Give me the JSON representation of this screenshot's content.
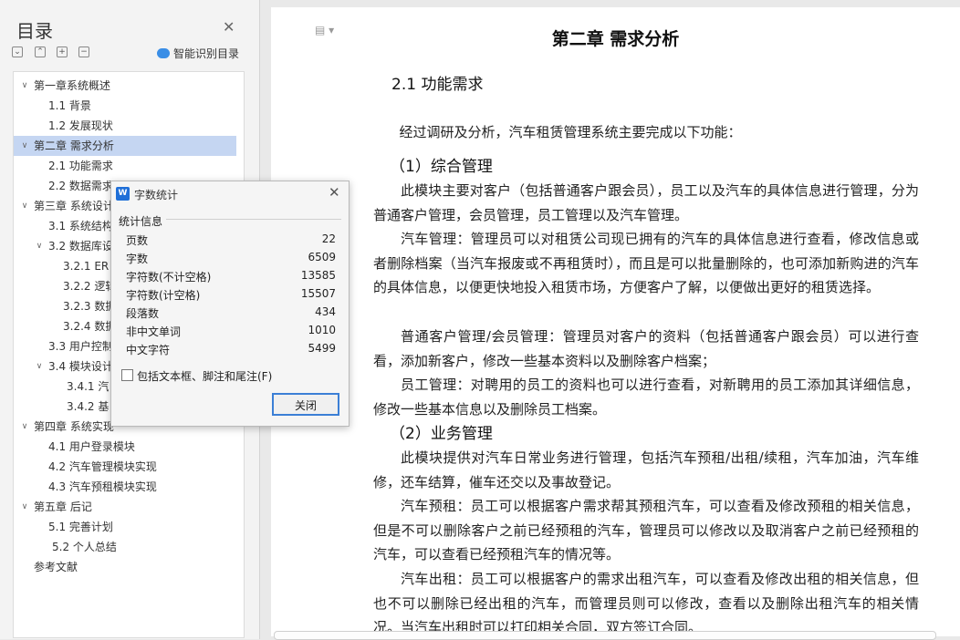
{
  "toc": {
    "title": "目录",
    "smart_label": "智能识别目录",
    "toolbar": [
      "⌄",
      "⌃",
      "+",
      "−"
    ],
    "items": [
      {
        "label": "第一章系统概述",
        "level": 0,
        "expanded": true
      },
      {
        "label": "1.1 背景",
        "level": 1
      },
      {
        "label": "1.2 发展现状",
        "level": 1
      },
      {
        "label": "第二章 需求分析",
        "level": 0,
        "expanded": true,
        "selected": true
      },
      {
        "label": "2.1 功能需求",
        "level": 1
      },
      {
        "label": "2.2 数据需求",
        "level": 1
      },
      {
        "label": "第三章 系统设计",
        "level": 0,
        "expanded": true
      },
      {
        "label": "3.1 系统结构",
        "level": 1
      },
      {
        "label": "3.2 数据库设",
        "level": 1,
        "expanded": true
      },
      {
        "label": "3.2.1 ER 图",
        "level": 2
      },
      {
        "label": "3.2.2 逻辑",
        "level": 2
      },
      {
        "label": "3.2.3 数据",
        "level": 2
      },
      {
        "label": "3.2.4 数据",
        "level": 2
      },
      {
        "label": "3.3 用户控制",
        "level": 1
      },
      {
        "label": "3.4 模块设计",
        "level": 1,
        "expanded": true
      },
      {
        "label": "3.4.1 汽",
        "level": 3
      },
      {
        "label": "3.4.2 基",
        "level": 3
      },
      {
        "label": "第四章 系统实现",
        "level": 0,
        "expanded": true
      },
      {
        "label": "4.1 用户登录模块",
        "level": 1
      },
      {
        "label": "4.2 汽车管理模块实现",
        "level": 1
      },
      {
        "label": "4.3 汽车预租模块实现",
        "level": 1
      },
      {
        "label": "第五章 后记",
        "level": 0,
        "expanded": true
      },
      {
        "label": "5.1 完善计划",
        "level": 1
      },
      {
        "label": "5.2 个人总结",
        "level": 4
      },
      {
        "label": "参考文献",
        "level": 0,
        "expanded": false
      }
    ]
  },
  "doc": {
    "chapter_title": "第二章  需求分析",
    "section_title": "2.1  功能需求",
    "blocks": [
      {
        "type": "p",
        "text": "经过调研及分析，汽车租赁管理系统主要完成以下功能："
      },
      {
        "type": "h",
        "text": "（1）综合管理"
      },
      {
        "type": "p",
        "text": "此模块主要对客户（包括普通客户跟会员），员工以及汽车的具体信息进行管理，分为普通客户管理，会员管理，员工管理以及汽车管理。"
      },
      {
        "type": "p",
        "text": "汽车管理：管理员可以对租赁公司现已拥有的汽车的具体信息进行查看，修改信息或者删除档案（当汽车报废或不再租赁时），而且是可以批量删除的，也可添加新购进的汽车的具体信息，以便更快地投入租赁市场，方便客户了解，以便做出更好的租赁选择。"
      },
      {
        "type": "p",
        "text": "普通客户管理/会员管理：管理员对客户的资料（包括普通客户跟会员）可以进行查看，添加新客户，修改一些基本资料以及删除客户档案；"
      },
      {
        "type": "p",
        "text": "员工管理：对聘用的员工的资料也可以进行查看，对新聘用的员工添加其详细信息，修改一些基本信息以及删除员工档案。"
      },
      {
        "type": "h",
        "text": "（2）业务管理"
      },
      {
        "type": "p",
        "text": "此模块提供对汽车日常业务进行管理，包括汽车预租/出租/续租，汽车加油，汽车维修，还车结算，催车还交以及事故登记。"
      },
      {
        "type": "p",
        "text": "汽车预租：员工可以根据客户需求帮其预租汽车，可以查看及修改预租的相关信息，但是不可以删除客户之前已经预租的汽车，管理员可以修改以及取消客户之前已经预租的汽车，可以查看已经预租汽车的情况等。"
      },
      {
        "type": "p",
        "text": "汽车出租：员工可以根据客户的需求出租汽车，可以查看及修改出租的相关信息，但也不可以删除已经出租的汽车，而管理员则可以修改，查看以及删除出租汽车的相关情况。当汽车出租时可以打印相关合同，双方签订合同。"
      }
    ]
  },
  "dialog": {
    "title": "字数统计",
    "logo": "W",
    "group_title": "统计信息",
    "stats": [
      {
        "label": "页数",
        "value": "22"
      },
      {
        "label": "字数",
        "value": "6509"
      },
      {
        "label": "字符数(不计空格)",
        "value": "13585"
      },
      {
        "label": "字符数(计空格)",
        "value": "15507"
      },
      {
        "label": "段落数",
        "value": "434"
      },
      {
        "label": "非中文单词",
        "value": "1010"
      },
      {
        "label": "中文字符",
        "value": "5499"
      }
    ],
    "checkbox_label": "包括文本框、脚注和尾注(F)",
    "close_button": "关闭"
  }
}
